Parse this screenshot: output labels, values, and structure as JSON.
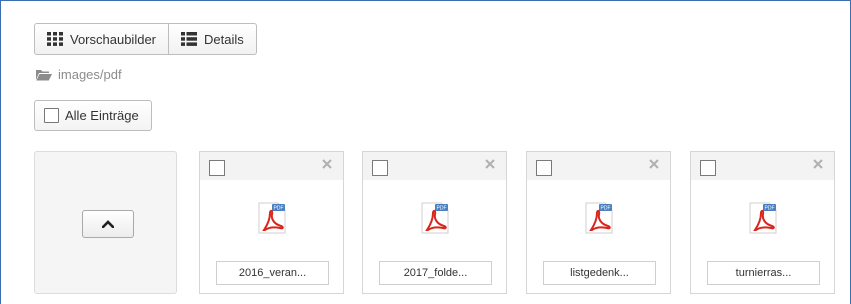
{
  "view_toggle": {
    "thumbnails_label": "Vorschaubilder",
    "details_label": "Details"
  },
  "breadcrumb": {
    "path": "images/pdf"
  },
  "select_all": {
    "label": "Alle Einträge"
  },
  "files": [
    {
      "name": "2016_veran...",
      "type": "pdf",
      "icon": "pdf-file-icon"
    },
    {
      "name": "2017_folde...",
      "type": "pdf",
      "icon": "pdf-file-icon"
    },
    {
      "name": "listgedenk...",
      "type": "pdf",
      "icon": "pdf-file-icon"
    },
    {
      "name": "turnierras...",
      "type": "pdf",
      "icon": "pdf-file-icon"
    }
  ],
  "colors": {
    "frame_border": "#3a6fb0",
    "pdf_red": "#d9251c",
    "pdf_badge": "#4a7fc1",
    "muted_text": "#8c8c8c"
  }
}
